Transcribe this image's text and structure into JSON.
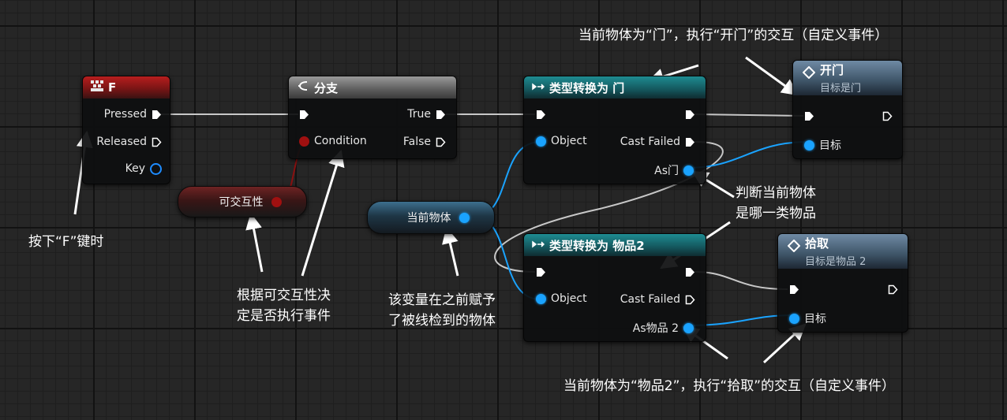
{
  "nodes": {
    "key_f": {
      "title": "F",
      "pins": {
        "pressed": "Pressed",
        "released": "Released",
        "key": "Key"
      }
    },
    "branch": {
      "title": "分支",
      "pins": {
        "condition": "Condition",
        "true": "True",
        "false": "False"
      }
    },
    "cast_door": {
      "title": "类型转换为 门",
      "pins": {
        "object": "Object",
        "cast_failed": "Cast Failed",
        "as": "As门"
      }
    },
    "cast_item": {
      "title": "类型转换为 物品2",
      "pins": {
        "object": "Object",
        "cast_failed": "Cast Failed",
        "as": "As物品 2"
      }
    },
    "open_door": {
      "title": "开门",
      "subtitle": "目标是门",
      "pins": {
        "target": "目标"
      }
    },
    "pickup": {
      "title": "拾取",
      "subtitle": "目标是物品 2",
      "pins": {
        "target": "目标"
      }
    }
  },
  "variables": {
    "interactable": "可交互性",
    "current_object": "当前物体"
  },
  "annotations": {
    "press_f": "按下“F”键时",
    "branch_note_1": "根据可交互性决",
    "branch_note_2": "定是否执行事件",
    "var_note_1": "该变量在之前赋予",
    "var_note_2": "了被线检到的物体",
    "judge_1": "判断当前物体",
    "judge_2": "是哪一类物品",
    "door_event": "当前物体为“门”，执行“开门”的交互（自定义事件）",
    "item_event": "当前物体为“物品2”，执行“拾取”的交互（自定义事件）"
  },
  "colors": {
    "exec_wire": "#c8c8c8",
    "object_wire": "#1aa3ff",
    "bool_pin": "#a01010",
    "key_header": "#b81e1e",
    "branch_header": "#6a6a6a",
    "cast_header": "#1e8c92",
    "event_header": "#4a6278"
  },
  "icons": {
    "key_node": "keyboard-icon",
    "branch_node": "branch-icon",
    "cast_node": "cast-arrow-icon",
    "event_node": "function-diamond-icon"
  }
}
